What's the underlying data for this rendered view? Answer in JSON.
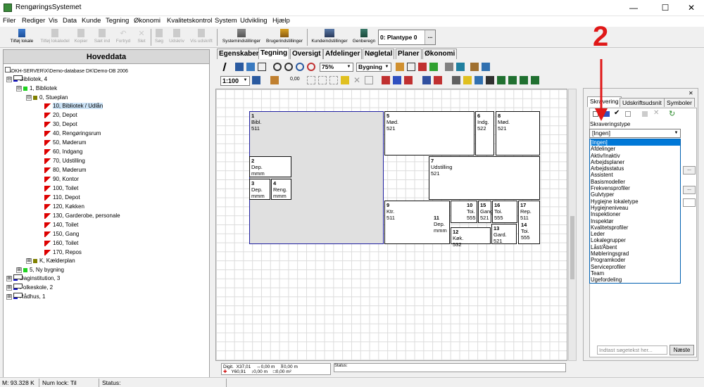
{
  "window": {
    "title": "RengøringsSystemet",
    "minimize": "—",
    "maximize": "☐",
    "close": "✕"
  },
  "menu": [
    "Filer",
    "Rediger",
    "Vis",
    "Data",
    "Kunde",
    "Tegning",
    "Økonomi",
    "Kvalitetskontrol",
    "System",
    "Udvikling",
    "Hjælp"
  ],
  "toolbar": {
    "buttons": [
      "Tilføj lokale",
      "Tilføj lokaledel",
      "Kopier",
      "Sæt ind",
      "Fortryd",
      "Slet",
      "Søg",
      "Udskriv",
      "Vis udskrift",
      "Systemindstillinger",
      "Brugerindstillinger",
      "Kundeindstillinger",
      "Genberegn"
    ],
    "plantype": "0: Plantype 0",
    "plantype_btn": "..."
  },
  "left": {
    "header": "Hoveddata",
    "root": "C:\\DKH-SERVER\\X\\Demo-database DK\\Demo-DB 2006",
    "tree": [
      {
        "label": "Bibliotek, 4",
        "expander": "⊟"
      },
      {
        "label": "1, Bibliotek",
        "expander": "⊟"
      },
      {
        "label": "0, Stueplan",
        "expander": "⊟"
      },
      {
        "label": "10, Bibliotek / Udlån"
      },
      {
        "label": "20, Depot"
      },
      {
        "label": "30, Depot"
      },
      {
        "label": "40, Rengøringsrum"
      },
      {
        "label": "50, Møderum"
      },
      {
        "label": "60, Indgang"
      },
      {
        "label": "70, Udstilling"
      },
      {
        "label": "80, Møderum"
      },
      {
        "label": "90, Kontor"
      },
      {
        "label": "100, Toilet"
      },
      {
        "label": "110, Depot"
      },
      {
        "label": "120, Køkken"
      },
      {
        "label": "130, Garderobe, personale"
      },
      {
        "label": "140, Toilet"
      },
      {
        "label": "150, Gang"
      },
      {
        "label": "160, Toilet"
      },
      {
        "label": "170, Repos"
      },
      {
        "label": "K, Kælderplan",
        "expander": "⊞"
      },
      {
        "label": "5, Ny bygning",
        "expander": "⊞"
      },
      {
        "label": "Daginstitution, 3",
        "expander": "⊞"
      },
      {
        "label": "Folkeskole, 2",
        "expander": "⊞"
      },
      {
        "label": "Rådhus, 1",
        "expander": "⊞"
      }
    ]
  },
  "drawing": {
    "tabs": [
      "Egenskaber",
      "Tegning",
      "Oversigt",
      "Afdelinger",
      "Nøgletal",
      "Planer",
      "Økonomi"
    ],
    "zoom": "75%",
    "filter": "Bygning",
    "scale": "1:100",
    "stroke": "0,00",
    "rooms": [
      {
        "num": "1",
        "name": "Bibl.",
        "code": "511"
      },
      {
        "num": "2",
        "name": "Dep.",
        "code": "mmm"
      },
      {
        "num": "3",
        "name": "Dep.",
        "code": "mmm"
      },
      {
        "num": "4",
        "name": "Reng.",
        "code": "mmm"
      },
      {
        "num": "5",
        "name": "Mød.",
        "code": "521"
      },
      {
        "num": "6",
        "name": "Indg.",
        "code": "522"
      },
      {
        "num": "8",
        "name": "Mød.",
        "code": "521"
      },
      {
        "num": "7",
        "name": "Udstilling",
        "code": "521"
      },
      {
        "num": "9",
        "name": "Ktr.",
        "code": "511"
      },
      {
        "num": "11",
        "name": "Dep.",
        "code": "mmm"
      },
      {
        "num": "10",
        "name": "Toi.",
        "code": "555"
      },
      {
        "num": "15",
        "name": "Gang",
        "code": "521"
      },
      {
        "num": "16",
        "name": "Toi.",
        "code": "555"
      },
      {
        "num": "17",
        "name": "Rep.",
        "code": "511"
      },
      {
        "num": "14",
        "name": "Toi.",
        "code": "555"
      },
      {
        "num": "12",
        "name": "Køk.",
        "code": "532"
      },
      {
        "num": "13",
        "name": "Gard.",
        "code": "521"
      }
    ],
    "status": {
      "digit": "Digit.",
      "x": "37,01",
      "y": "60,91",
      "v1": "0,00 m",
      "v2": "0,00 m",
      "v3": "0,00 m",
      "v4": "0,00 m²",
      "status_label": "Status:"
    }
  },
  "right": {
    "tabs": [
      "Skravering",
      "Udskriftsudsnit",
      "Symboler"
    ],
    "type_label": "Skraveringstype",
    "selected": "[Ingen]",
    "options": [
      "[Ingen]",
      "Afdelinger",
      "Aktiv/Inaktiv",
      "Arbejdsplaner",
      "Arbejdsstatus",
      "Assistent",
      "Basismodeller",
      "Frekvensprofiler",
      "Gulvtyper",
      "Hygiejne lokaletype",
      "Hygiejneniveau",
      "Inspektioner",
      "Inspektør",
      "Kvalitetsprofiler",
      "Leder",
      "Lokalegrupper",
      "Låst/Åbent",
      "Møbleringsgrad",
      "Programkoder",
      "Serviceprofiler",
      "Team",
      "Ugefordeling"
    ],
    "search_placeholder": "Indtast søgetekst her...",
    "next": "Næste",
    "annotation": "2"
  },
  "statusbar": {
    "m": "M: 93.328 K",
    "numlock": "Num lock: Til",
    "status": "Status:"
  }
}
